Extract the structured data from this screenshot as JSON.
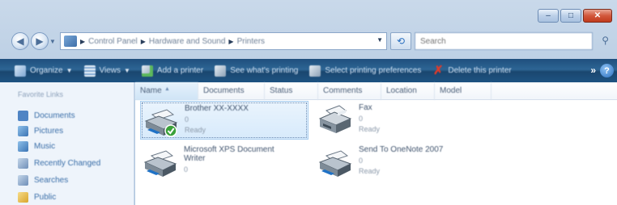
{
  "window": {
    "minimize": "–",
    "maximize": "□",
    "close": "✕"
  },
  "nav": {
    "back_icon": "back-arrow-icon",
    "forward_icon": "forward-arrow-icon",
    "breadcrumb": [
      "Control Panel",
      "Hardware and Sound",
      "Printers"
    ],
    "search_placeholder": "Search"
  },
  "toolbar": {
    "items": [
      {
        "label": "Organize",
        "icon": "organize-icon",
        "dropdown": true
      },
      {
        "label": "Views",
        "icon": "views-icon",
        "dropdown": true
      },
      {
        "label": "Add a printer",
        "icon": "add-printer-icon"
      },
      {
        "label": "See what's printing",
        "icon": "printer-queue-icon"
      },
      {
        "label": "Select printing preferences",
        "icon": "printer-prefs-icon"
      },
      {
        "label": "Delete this printer",
        "icon": "delete-icon"
      }
    ],
    "more": "»",
    "help": "?"
  },
  "sidebar": {
    "heading": "Favorite Links",
    "items": [
      {
        "label": "Documents",
        "icon": "documents-icon",
        "color": "#4f84c4"
      },
      {
        "label": "Pictures",
        "icon": "pictures-icon",
        "color": "#4f84c4"
      },
      {
        "label": "Music",
        "icon": "music-icon",
        "color": "#4f84c4"
      },
      {
        "label": "Recently Changed",
        "icon": "recent-icon",
        "color": "#6f8fb8"
      },
      {
        "label": "Searches",
        "icon": "searches-icon",
        "color": "#6f8fb8"
      },
      {
        "label": "Public",
        "icon": "public-icon",
        "color": "#e2b542"
      }
    ]
  },
  "columns": [
    "Name",
    "Documents",
    "Status",
    "Comments",
    "Location",
    "Model"
  ],
  "printers": [
    {
      "name": "Brother XX-XXXX",
      "docs": "0",
      "status": "Ready",
      "default": true,
      "selected": true
    },
    {
      "name": "Fax",
      "docs": "0",
      "status": "Ready",
      "default": false,
      "selected": false
    },
    {
      "name": "Microsoft XPS Document",
      "name2": "Writer",
      "docs": "0",
      "status": "",
      "default": false,
      "selected": false
    },
    {
      "name": "Send To OneNote 2007",
      "docs": "0",
      "status": "Ready",
      "default": false,
      "selected": false
    }
  ]
}
